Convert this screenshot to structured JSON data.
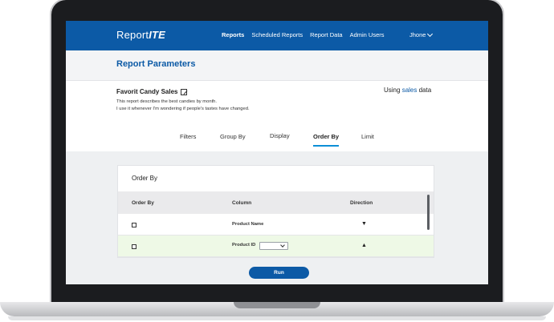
{
  "app": {
    "logo_prefix": "Report",
    "logo_suffix": "ITE"
  },
  "nav": {
    "links": [
      "Reports",
      "Scheduled Reports",
      "Report Data",
      "Admin Users"
    ],
    "active": "Reports",
    "user": "Jhone"
  },
  "page": {
    "title": "Report Parameters"
  },
  "report": {
    "name": "Favorit Candy Sales",
    "description_line1": "This report describes the best candies by month.",
    "description_line2": "I use it whenever I'm wondering if people's tastes have changed.",
    "using_prefix": "Using",
    "source": "sales",
    "using_suffix": "data"
  },
  "tabs": [
    "Filters",
    "Group By",
    "Display",
    "Order By",
    "Limit"
  ],
  "active_tab": "Order By",
  "order_by": {
    "card_title": "Order By",
    "headers": [
      "Order By",
      "Column",
      "Direction"
    ],
    "rows": [
      {
        "column": "Product Name",
        "direction": "▼"
      },
      {
        "column": "Product ID",
        "direction": "▲"
      }
    ]
  },
  "run_label": "Run",
  "colors": {
    "brand": "#0c5aa6",
    "tab_underline": "#0c8fd6",
    "selected_row": "#eef9e6"
  }
}
